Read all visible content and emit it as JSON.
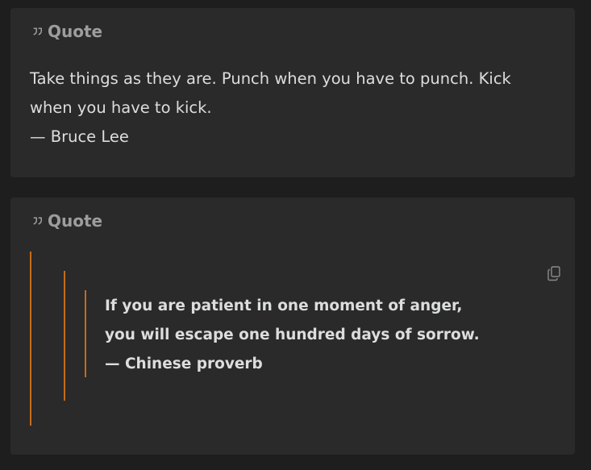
{
  "callouts": [
    {
      "title": "Quote",
      "icon": "quote-icon",
      "lines": [
        "Take things as they are. Punch when you have to punch. Kick when you have to kick.",
        "— Bruce Lee"
      ]
    },
    {
      "title": "Quote",
      "icon": "quote-icon",
      "copy_icon": "copy-icon",
      "nested_quote_lines": [
        "If you are patient in one moment of anger,",
        "you will escape one hundred days of sorrow.",
        "— Chinese proverb"
      ]
    }
  ],
  "colors": {
    "background": "#1e1e1e",
    "card": "#2a2a2a",
    "title_text": "#9d9d9d",
    "body_text": "#dcddde",
    "blockquote_border": "#c56c1a"
  }
}
